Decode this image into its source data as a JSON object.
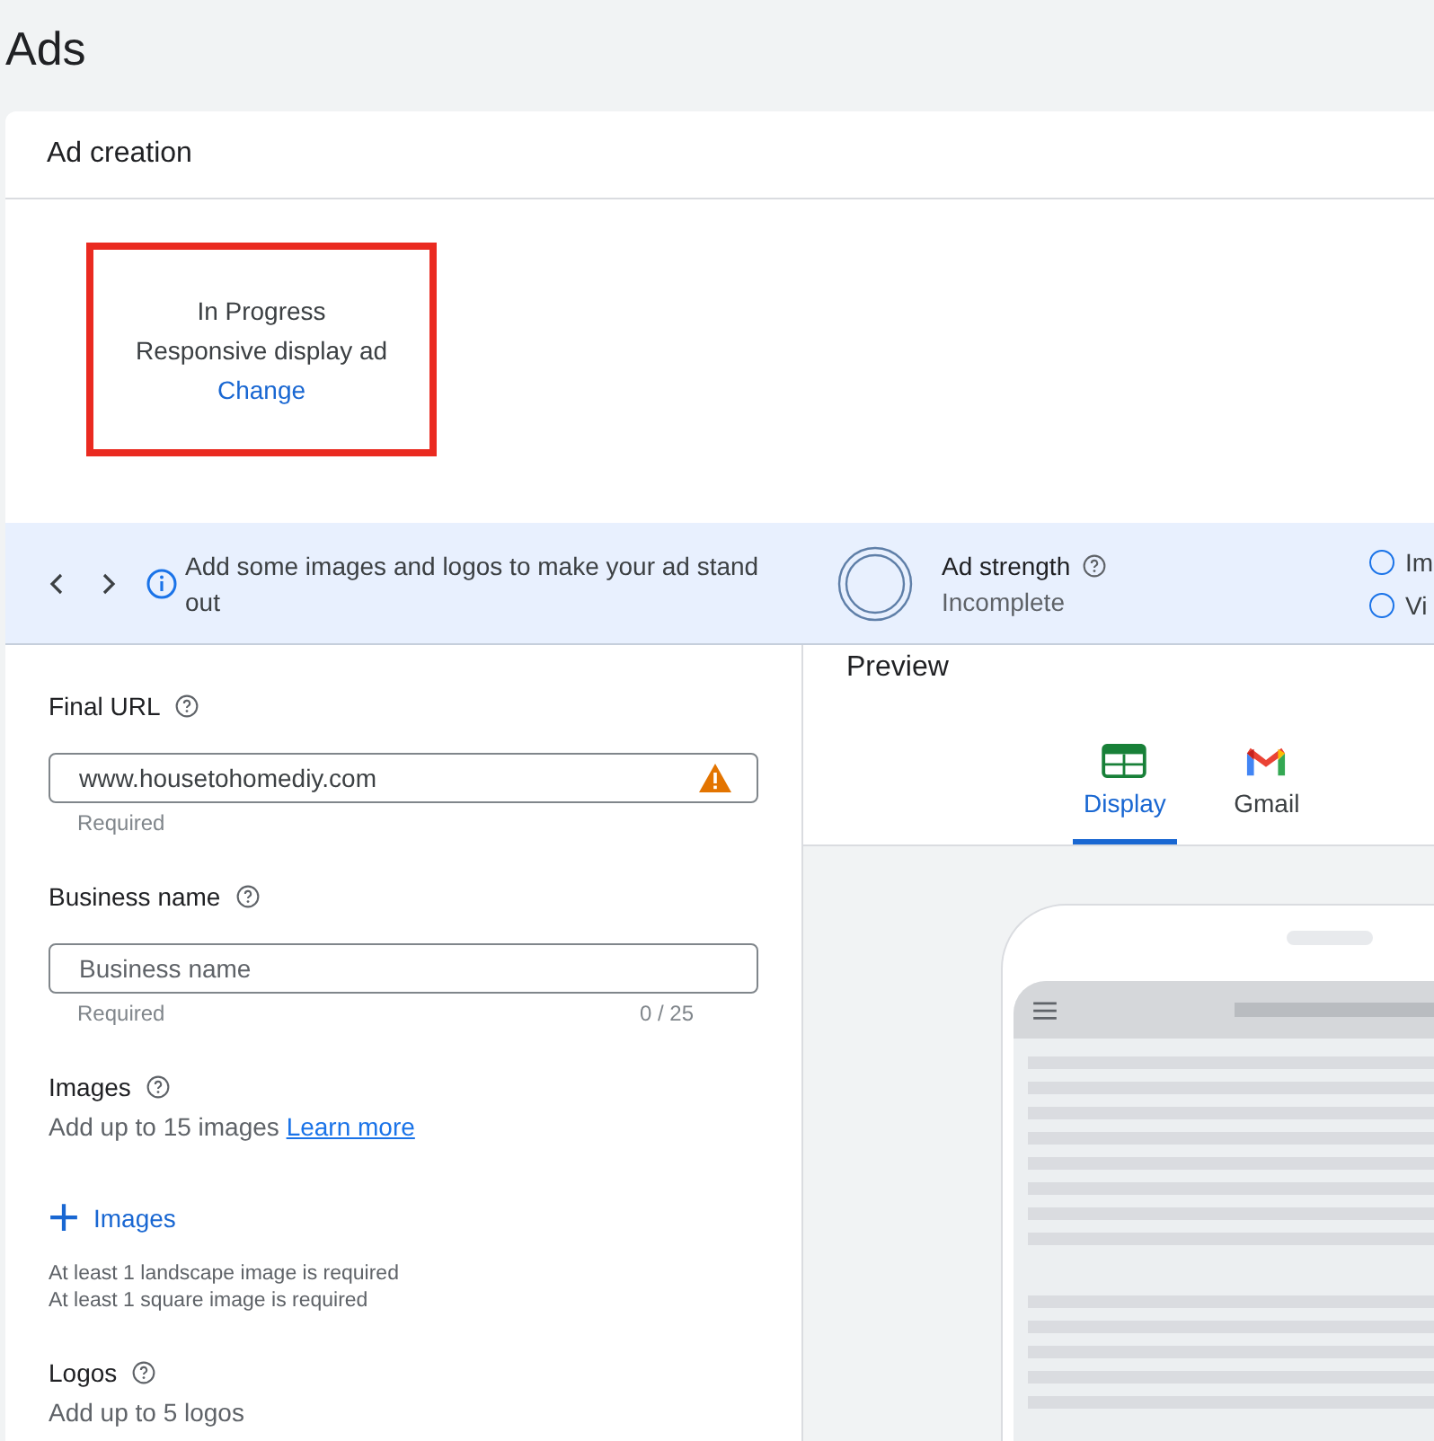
{
  "page_title": "Ads",
  "card_title": "Ad creation",
  "ad_type": {
    "status": "In Progress",
    "name": "Responsive display ad",
    "link": "Change"
  },
  "banner": {
    "message": "Add some images and logos to make your ad stand out",
    "strength_label": "Ad strength",
    "strength_value": "Incomplete",
    "options": [
      {
        "label": "Im",
        "selected": false
      },
      {
        "label": "Vi",
        "selected": false
      }
    ]
  },
  "form": [
    {
      "kind": "field",
      "label": "Final URL",
      "value": "www.housetohomediy.com",
      "warning": true,
      "helper": "Required"
    },
    {
      "kind": "field",
      "label": "Business name",
      "placeholder": "Business name",
      "warning": false,
      "helper": "Required",
      "counter": "0 / 25"
    },
    {
      "kind": "assets",
      "label": "Images",
      "description": "Add up to 15 images",
      "link": "Learn more",
      "add_label": "Images",
      "notes": [
        "At least 1 landscape image is required",
        "At least 1 square image is required"
      ]
    },
    {
      "kind": "assets",
      "label": "Logos",
      "description": "Add up to 5 logos"
    }
  ],
  "preview": {
    "title": "Preview",
    "tabs": [
      {
        "kind": "display",
        "label": "Display",
        "selected": true
      },
      {
        "kind": "gmail",
        "label": "Gmail",
        "selected": false
      }
    ]
  }
}
